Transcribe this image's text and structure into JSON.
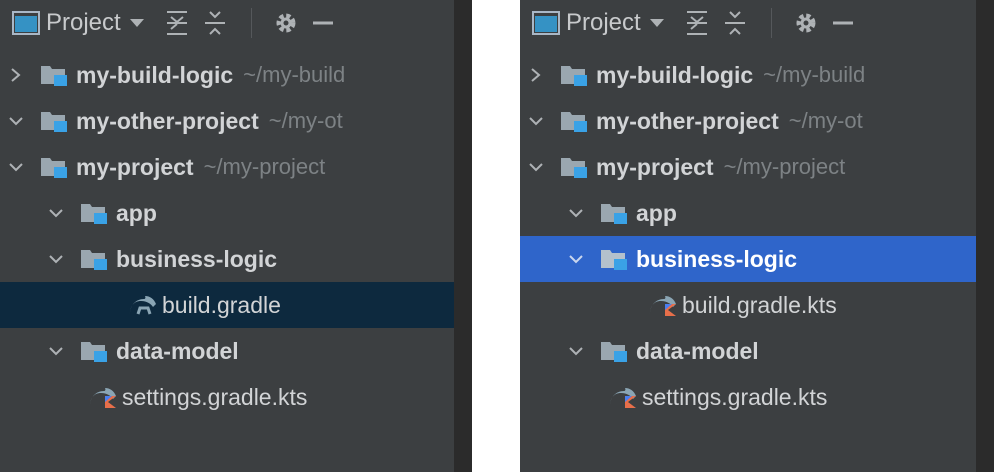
{
  "colors": {
    "panel_bg": "#3c3f41",
    "selection_inactive": "#0d293e",
    "selection_active": "#2f65ca",
    "text": "#d2d4d6",
    "path_text": "#7d8285",
    "module_badge": "#3aa2e6"
  },
  "panels": [
    {
      "toolbar": {
        "title": "Project",
        "icons": [
          "project-window-icon",
          "dropdown-icon",
          "expand-all-icon",
          "collapse-all-icon",
          "gear-icon",
          "minimize-icon"
        ]
      },
      "tree": [
        {
          "label": "my-build-logic",
          "path": "~/my-build",
          "expanded": false,
          "icon": "module-folder-icon"
        },
        {
          "label": "my-other-project",
          "path": "~/my-ot",
          "expanded": true,
          "icon": "module-folder-icon"
        },
        {
          "label": "my-project",
          "path": "~/my-project",
          "expanded": true,
          "icon": "module-folder-icon"
        },
        {
          "label": "app",
          "expanded": true,
          "icon": "module-folder-icon"
        },
        {
          "label": "business-logic",
          "expanded": true,
          "icon": "module-folder-icon"
        },
        {
          "label": "build.gradle",
          "icon": "gradle-icon",
          "selected": "inactive"
        },
        {
          "label": "data-model",
          "expanded": true,
          "icon": "module-folder-icon"
        },
        {
          "label": "settings.gradle.kts",
          "icon": "gradle-kotlin-icon"
        }
      ]
    },
    {
      "toolbar": {
        "title": "Project",
        "icons": [
          "project-window-icon",
          "dropdown-icon",
          "expand-all-icon",
          "collapse-all-icon",
          "gear-icon",
          "minimize-icon"
        ]
      },
      "tree": [
        {
          "label": "my-build-logic",
          "path": "~/my-build",
          "expanded": false,
          "icon": "module-folder-icon"
        },
        {
          "label": "my-other-project",
          "path": "~/my-ot",
          "expanded": true,
          "icon": "module-folder-icon"
        },
        {
          "label": "my-project",
          "path": "~/my-project",
          "expanded": true,
          "icon": "module-folder-icon"
        },
        {
          "label": "app",
          "expanded": true,
          "icon": "module-folder-icon"
        },
        {
          "label": "business-logic",
          "expanded": true,
          "icon": "module-folder-icon",
          "selected": "active"
        },
        {
          "label": "build.gradle.kts",
          "icon": "gradle-kotlin-icon"
        },
        {
          "label": "data-model",
          "expanded": true,
          "icon": "module-folder-icon"
        },
        {
          "label": "settings.gradle.kts",
          "icon": "gradle-kotlin-icon"
        }
      ]
    }
  ]
}
